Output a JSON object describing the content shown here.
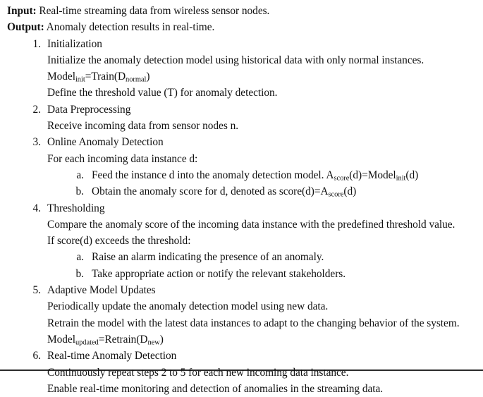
{
  "algorithm": {
    "io": [
      {
        "label": "Input:",
        "text": " Real-time streaming data from wireless sensor nodes."
      },
      {
        "label": "Output:",
        "text": " Anomaly detection results in real-time."
      }
    ],
    "steps": [
      {
        "marker": "1.",
        "title": "Initialization",
        "lines": [
          {
            "type": "text",
            "text": "Initialize the anomaly detection model using historical data with only normal instances."
          },
          {
            "type": "formula",
            "parts": [
              {
                "base": "Model",
                "sub": "init"
              },
              {
                "base": "=Train(D",
                "sub": "normal"
              },
              {
                "base": ")",
                "sub": ""
              }
            ]
          },
          {
            "type": "text",
            "text": "Define the threshold value (T) for anomaly detection."
          }
        ],
        "substeps": []
      },
      {
        "marker": "2.",
        "title": "Data Preprocessing",
        "lines": [
          {
            "type": "text",
            "text": "Receive incoming data from sensor nodes n."
          }
        ],
        "substeps": []
      },
      {
        "marker": "3.",
        "title": "Online Anomaly Detection",
        "lines": [
          {
            "type": "text",
            "text": "For each incoming data instance d:"
          }
        ],
        "substeps": [
          {
            "marker": "a.",
            "type": "formula",
            "parts": [
              {
                "base": "Feed the instance d into the anomaly detection model. A",
                "sub": "score"
              },
              {
                "base": "(d)=Model",
                "sub": "init"
              },
              {
                "base": "(d)",
                "sub": ""
              }
            ]
          },
          {
            "marker": "b.",
            "type": "formula",
            "parts": [
              {
                "base": "Obtain the anomaly score for d, denoted as score(d)=A",
                "sub": "score"
              },
              {
                "base": "(d)",
                "sub": ""
              }
            ]
          }
        ]
      },
      {
        "marker": "4.",
        "title": "Thresholding",
        "lines": [
          {
            "type": "text",
            "text": "Compare the anomaly score of the incoming data instance with the predefined threshold value."
          },
          {
            "type": "text",
            "text": "If score(d) exceeds the threshold:"
          }
        ],
        "substeps": [
          {
            "marker": "a.",
            "type": "text",
            "text": "Raise an alarm indicating the presence of an anomaly."
          },
          {
            "marker": "b.",
            "type": "text",
            "text": "Take appropriate action or notify the relevant stakeholders."
          }
        ]
      },
      {
        "marker": "5.",
        "title": "Adaptive Model Updates",
        "lines": [
          {
            "type": "text",
            "text": "Periodically update the anomaly detection model using new data."
          },
          {
            "type": "text",
            "text": "Retrain the model with the latest data instances to adapt to the changing behavior of the system."
          },
          {
            "type": "formula",
            "parts": [
              {
                "base": "Model",
                "sub": "updated"
              },
              {
                "base": "=Retrain(D",
                "sub": "new"
              },
              {
                "base": ")",
                "sub": ""
              }
            ]
          }
        ],
        "substeps": []
      },
      {
        "marker": "6.",
        "title": "Real-time Anomaly Detection",
        "lines": [
          {
            "type": "text",
            "text": "Continuously repeat steps 2 to 5 for each new incoming data instance."
          },
          {
            "type": "text",
            "text": "Enable real-time monitoring and detection of anomalies in the streaming data."
          }
        ],
        "substeps": []
      }
    ]
  }
}
